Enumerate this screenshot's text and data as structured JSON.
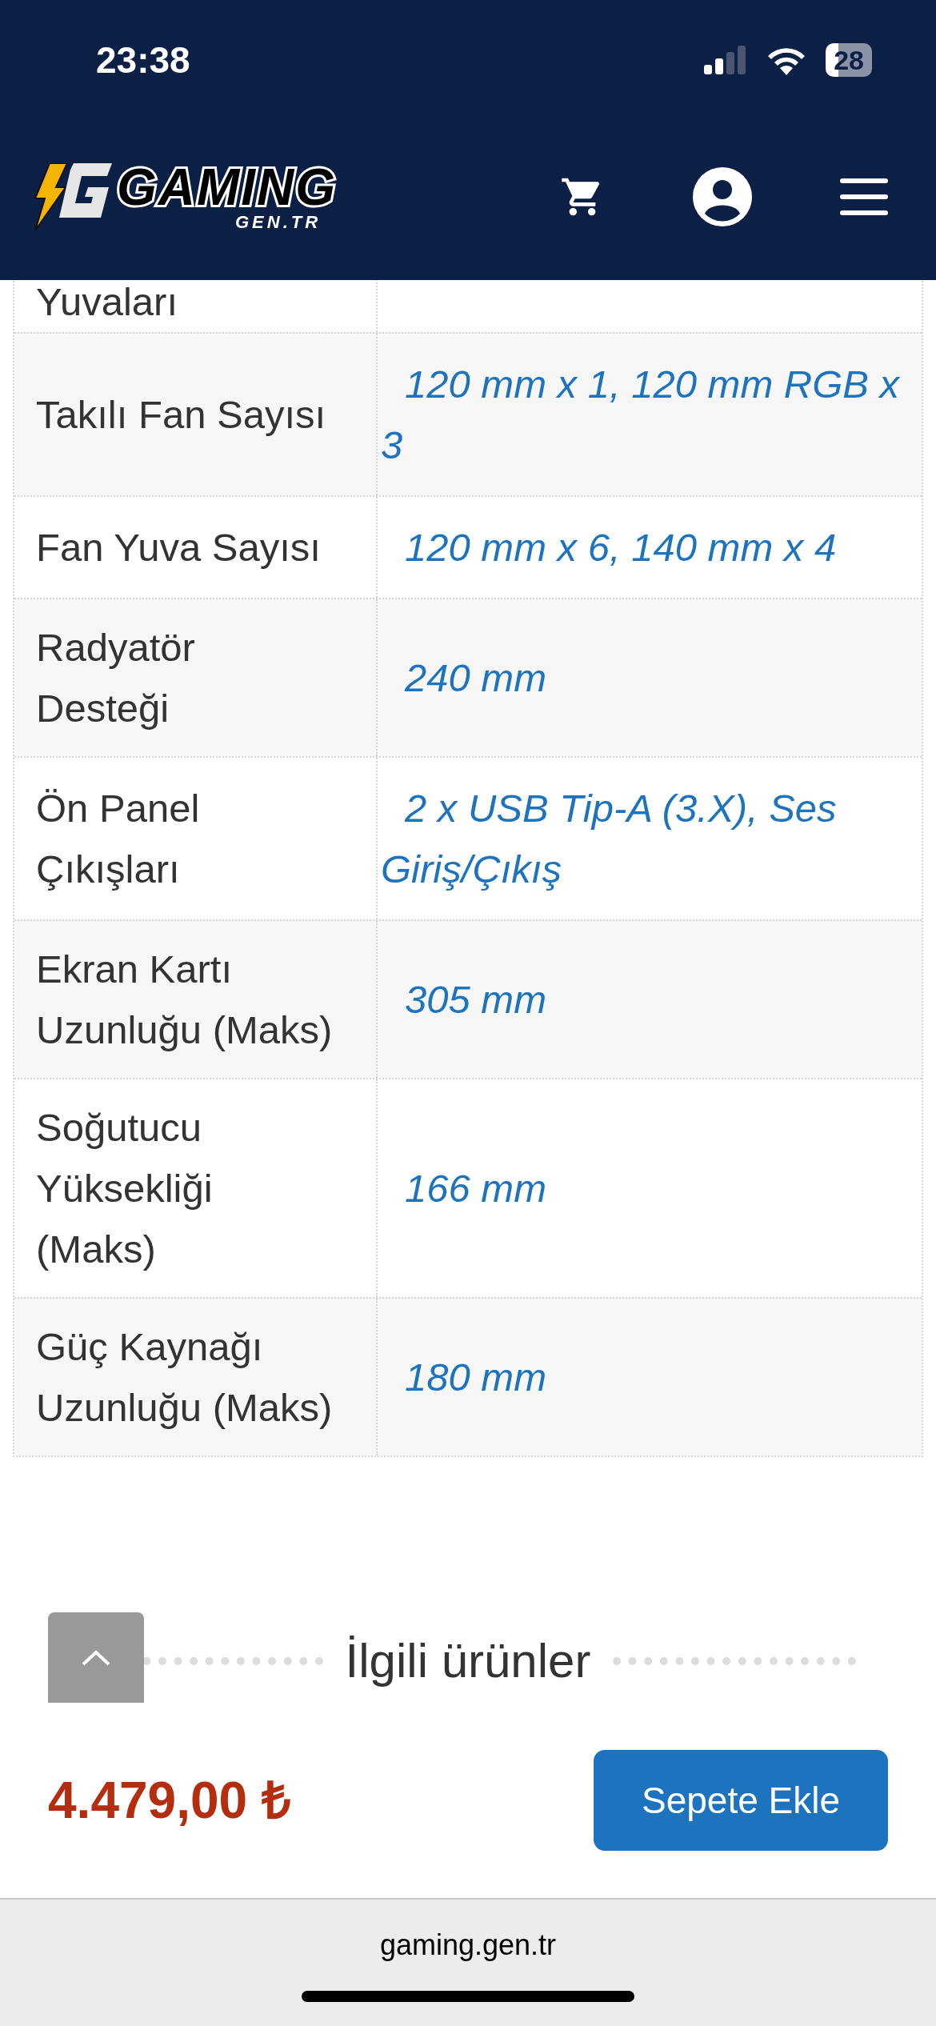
{
  "status_bar": {
    "time": "23:38",
    "battery": "28"
  },
  "header": {
    "logo": {
      "title": "GAMING",
      "subtitle": "GEN.TR"
    }
  },
  "spec_table": {
    "rows": [
      {
        "label": "Yuvaları",
        "value": ""
      },
      {
        "label": "Takılı Fan Sayısı",
        "value": "120 mm x 1, 120 mm RGB x 3"
      },
      {
        "label": "Fan Yuva Sayısı",
        "value": "120 mm x 6, 140 mm x 4"
      },
      {
        "label": "Radyatör Desteği",
        "value": "240 mm"
      },
      {
        "label": "Ön Panel Çıkışları",
        "value": "2 x USB Tip-A (3.X), Ses Giriş/Çıkış"
      },
      {
        "label": "Ekran Kartı Uzunluğu (Maks)",
        "value": "305 mm"
      },
      {
        "label": "Soğutucu Yüksekliği (Maks)",
        "value": "166 mm"
      },
      {
        "label": "Güç Kaynağı Uzunluğu (Maks)",
        "value": "180 mm"
      }
    ]
  },
  "related": {
    "title": "İlgili ürünler"
  },
  "bottom_bar": {
    "price": "4.479,00 ₺",
    "button": "Sepete Ekle"
  },
  "browser": {
    "url": "gaming.gen.tr"
  }
}
